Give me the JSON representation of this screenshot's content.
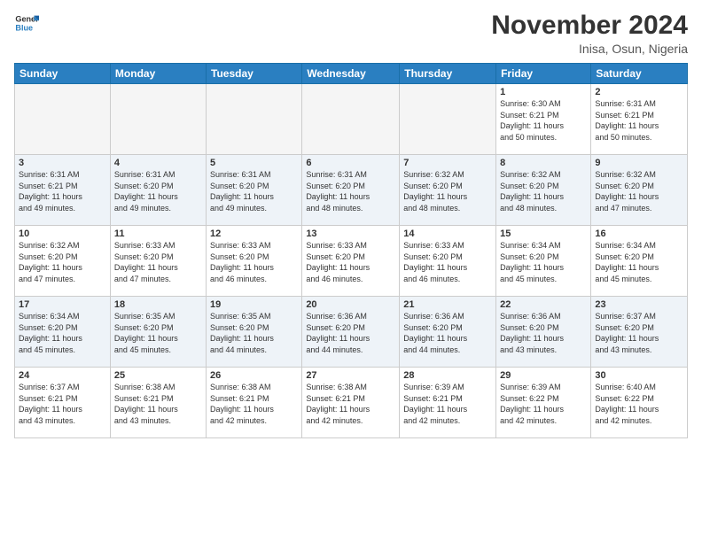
{
  "header": {
    "logo_general": "General",
    "logo_blue": "Blue",
    "month": "November 2024",
    "location": "Inisa, Osun, Nigeria"
  },
  "days_of_week": [
    "Sunday",
    "Monday",
    "Tuesday",
    "Wednesday",
    "Thursday",
    "Friday",
    "Saturday"
  ],
  "weeks": [
    [
      {
        "day": "",
        "info": ""
      },
      {
        "day": "",
        "info": ""
      },
      {
        "day": "",
        "info": ""
      },
      {
        "day": "",
        "info": ""
      },
      {
        "day": "",
        "info": ""
      },
      {
        "day": "1",
        "info": "Sunrise: 6:30 AM\nSunset: 6:21 PM\nDaylight: 11 hours\nand 50 minutes."
      },
      {
        "day": "2",
        "info": "Sunrise: 6:31 AM\nSunset: 6:21 PM\nDaylight: 11 hours\nand 50 minutes."
      }
    ],
    [
      {
        "day": "3",
        "info": "Sunrise: 6:31 AM\nSunset: 6:21 PM\nDaylight: 11 hours\nand 49 minutes."
      },
      {
        "day": "4",
        "info": "Sunrise: 6:31 AM\nSunset: 6:20 PM\nDaylight: 11 hours\nand 49 minutes."
      },
      {
        "day": "5",
        "info": "Sunrise: 6:31 AM\nSunset: 6:20 PM\nDaylight: 11 hours\nand 49 minutes."
      },
      {
        "day": "6",
        "info": "Sunrise: 6:31 AM\nSunset: 6:20 PM\nDaylight: 11 hours\nand 48 minutes."
      },
      {
        "day": "7",
        "info": "Sunrise: 6:32 AM\nSunset: 6:20 PM\nDaylight: 11 hours\nand 48 minutes."
      },
      {
        "day": "8",
        "info": "Sunrise: 6:32 AM\nSunset: 6:20 PM\nDaylight: 11 hours\nand 48 minutes."
      },
      {
        "day": "9",
        "info": "Sunrise: 6:32 AM\nSunset: 6:20 PM\nDaylight: 11 hours\nand 47 minutes."
      }
    ],
    [
      {
        "day": "10",
        "info": "Sunrise: 6:32 AM\nSunset: 6:20 PM\nDaylight: 11 hours\nand 47 minutes."
      },
      {
        "day": "11",
        "info": "Sunrise: 6:33 AM\nSunset: 6:20 PM\nDaylight: 11 hours\nand 47 minutes."
      },
      {
        "day": "12",
        "info": "Sunrise: 6:33 AM\nSunset: 6:20 PM\nDaylight: 11 hours\nand 46 minutes."
      },
      {
        "day": "13",
        "info": "Sunrise: 6:33 AM\nSunset: 6:20 PM\nDaylight: 11 hours\nand 46 minutes."
      },
      {
        "day": "14",
        "info": "Sunrise: 6:33 AM\nSunset: 6:20 PM\nDaylight: 11 hours\nand 46 minutes."
      },
      {
        "day": "15",
        "info": "Sunrise: 6:34 AM\nSunset: 6:20 PM\nDaylight: 11 hours\nand 45 minutes."
      },
      {
        "day": "16",
        "info": "Sunrise: 6:34 AM\nSunset: 6:20 PM\nDaylight: 11 hours\nand 45 minutes."
      }
    ],
    [
      {
        "day": "17",
        "info": "Sunrise: 6:34 AM\nSunset: 6:20 PM\nDaylight: 11 hours\nand 45 minutes."
      },
      {
        "day": "18",
        "info": "Sunrise: 6:35 AM\nSunset: 6:20 PM\nDaylight: 11 hours\nand 45 minutes."
      },
      {
        "day": "19",
        "info": "Sunrise: 6:35 AM\nSunset: 6:20 PM\nDaylight: 11 hours\nand 44 minutes."
      },
      {
        "day": "20",
        "info": "Sunrise: 6:36 AM\nSunset: 6:20 PM\nDaylight: 11 hours\nand 44 minutes."
      },
      {
        "day": "21",
        "info": "Sunrise: 6:36 AM\nSunset: 6:20 PM\nDaylight: 11 hours\nand 44 minutes."
      },
      {
        "day": "22",
        "info": "Sunrise: 6:36 AM\nSunset: 6:20 PM\nDaylight: 11 hours\nand 43 minutes."
      },
      {
        "day": "23",
        "info": "Sunrise: 6:37 AM\nSunset: 6:20 PM\nDaylight: 11 hours\nand 43 minutes."
      }
    ],
    [
      {
        "day": "24",
        "info": "Sunrise: 6:37 AM\nSunset: 6:21 PM\nDaylight: 11 hours\nand 43 minutes."
      },
      {
        "day": "25",
        "info": "Sunrise: 6:38 AM\nSunset: 6:21 PM\nDaylight: 11 hours\nand 43 minutes."
      },
      {
        "day": "26",
        "info": "Sunrise: 6:38 AM\nSunset: 6:21 PM\nDaylight: 11 hours\nand 42 minutes."
      },
      {
        "day": "27",
        "info": "Sunrise: 6:38 AM\nSunset: 6:21 PM\nDaylight: 11 hours\nand 42 minutes."
      },
      {
        "day": "28",
        "info": "Sunrise: 6:39 AM\nSunset: 6:21 PM\nDaylight: 11 hours\nand 42 minutes."
      },
      {
        "day": "29",
        "info": "Sunrise: 6:39 AM\nSunset: 6:22 PM\nDaylight: 11 hours\nand 42 minutes."
      },
      {
        "day": "30",
        "info": "Sunrise: 6:40 AM\nSunset: 6:22 PM\nDaylight: 11 hours\nand 42 minutes."
      }
    ]
  ]
}
